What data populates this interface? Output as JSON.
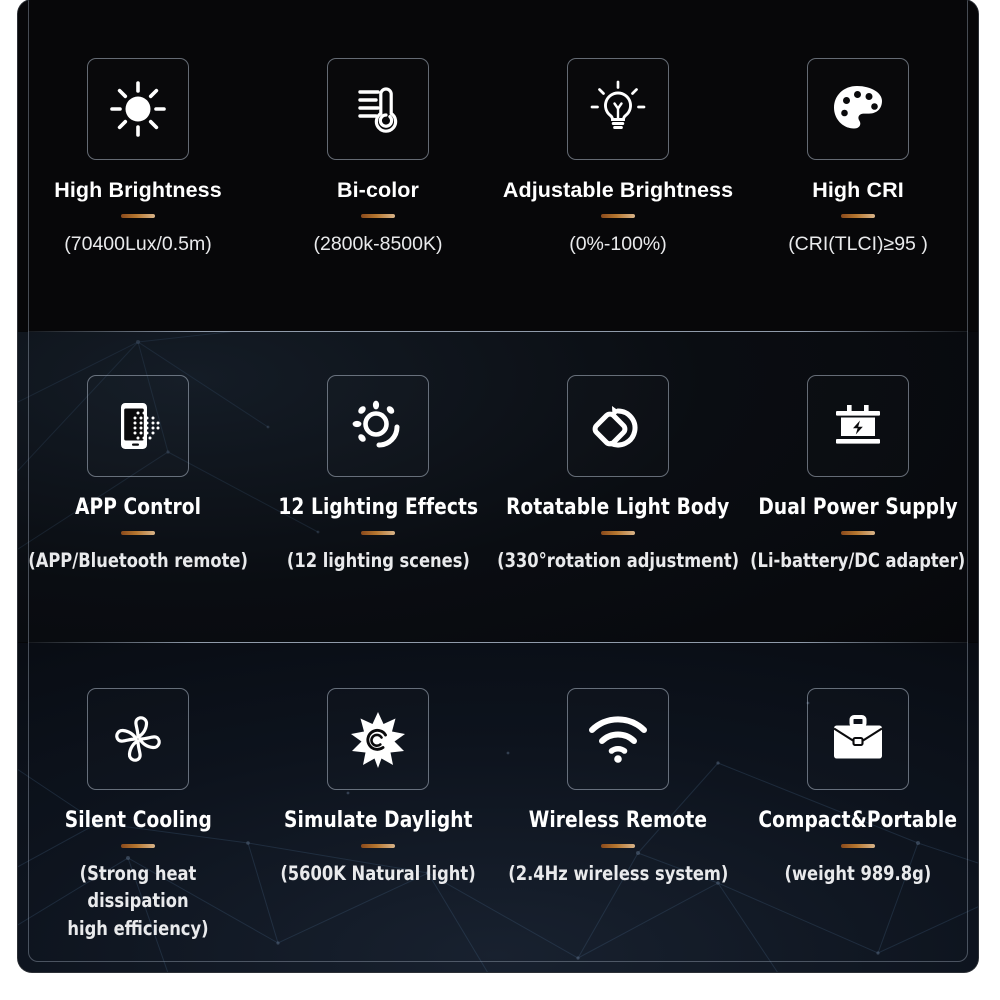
{
  "product_feature_grid": {
    "accent_color": "#b5762f",
    "panel_background": "#050608",
    "text_color": "#ffffff",
    "rows": [
      {
        "row_index": 1,
        "cells": [
          {
            "icon": "sun-brightness-icon",
            "title": "High Brightness",
            "subtitle": "(70400Lux/0.5m)"
          },
          {
            "icon": "thermometer-bicolor-icon",
            "title": "Bi-color",
            "subtitle": "(2800k-8500K)"
          },
          {
            "icon": "lightbulb-dimmer-icon",
            "title": "Adjustable Brightness",
            "subtitle": "(0%-100%)"
          },
          {
            "icon": "color-palette-icon",
            "title": "High CRI",
            "subtitle": "(CRI(TLCI)≥95 )"
          }
        ]
      },
      {
        "row_index": 2,
        "cells": [
          {
            "icon": "smartphone-app-icon",
            "title": "APP Control",
            "subtitle": "(APP/Bluetooth remote)"
          },
          {
            "icon": "lighting-effects-icon",
            "title": "12 Lighting Effects",
            "subtitle": "(12 lighting scenes)"
          },
          {
            "icon": "rotate-light-body-icon",
            "title": "Rotatable Light Body",
            "subtitle": "(330°rotation adjustment)"
          },
          {
            "icon": "battery-power-icon",
            "title": "Dual Power Supply",
            "subtitle": "(Li-battery/DC adapter)"
          }
        ]
      },
      {
        "row_index": 3,
        "cells": [
          {
            "icon": "fan-cooling-icon",
            "title": "Silent Cooling",
            "subtitle": "(Strong heat dissipation\nhigh efficiency)"
          },
          {
            "icon": "daylight-sun-icon",
            "title": "Simulate Daylight",
            "subtitle": "(5600K Natural light)"
          },
          {
            "icon": "wifi-wireless-icon",
            "title": "Wireless Remote",
            "subtitle": "(2.4Hz wireless system)"
          },
          {
            "icon": "briefcase-portable-icon",
            "title": "Compact&Portable",
            "subtitle": "(weight 989.8g)"
          }
        ]
      }
    ]
  }
}
